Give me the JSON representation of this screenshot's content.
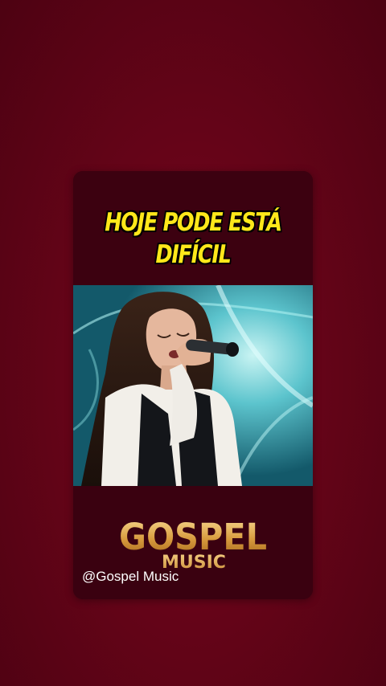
{
  "caption": {
    "line1": "HOJE PODE ESTÁ",
    "line2": "DIFÍCIL"
  },
  "brand": {
    "name": "GOSPEL",
    "subname": "MUSIC"
  },
  "handle": "@Gospel Music",
  "colors": {
    "background": "#650418",
    "card": "#3a0110",
    "caption_text": "#ffe81a",
    "brand_gold": "#d9a447",
    "video_glow": "#4fb8c2"
  }
}
